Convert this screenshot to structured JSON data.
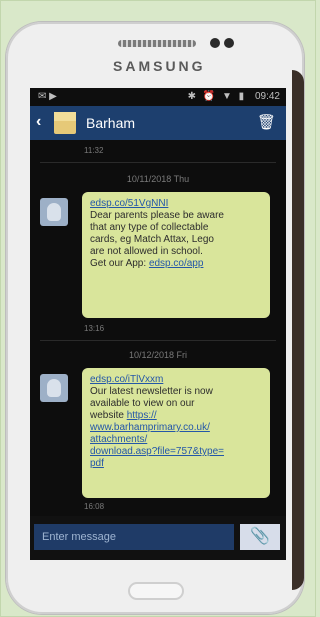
{
  "device": {
    "brand": "SAMSUNG"
  },
  "status_bar": {
    "time": "09:42"
  },
  "header": {
    "title": "Barham",
    "back_icon": "‹",
    "trash_icon": "🗑"
  },
  "messages": [
    {
      "timestamp_top": "11:32",
      "date": "10/11/2018 Thu",
      "link": "edsp.co/51VgNNI",
      "lines": [
        "Dear parents please be aware",
        "that any type of collectable",
        "cards, eg Match Attax, Lego",
        "are not allowed in school."
      ],
      "cta_prefix": "Get our App: ",
      "cta_link": "edsp.co/app",
      "time": "13:16"
    },
    {
      "date": "10/12/2018 Fri",
      "link": "edsp.co/iTlVxxm",
      "lines": [
        "Our latest newsletter is now",
        "available to view on our",
        "website "
      ],
      "url_parts": [
        "https://",
        "www.barhamprimary.co.uk/",
        "attachments/",
        "download.asp?file=757&type=",
        "pdf"
      ],
      "time": "16:08"
    }
  ],
  "input": {
    "placeholder": "Enter message",
    "attach_icon": "📎"
  }
}
